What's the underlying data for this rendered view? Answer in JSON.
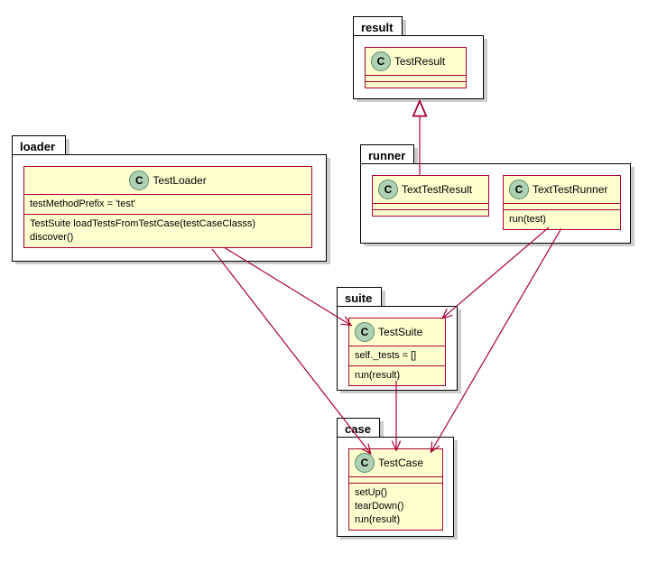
{
  "packages": {
    "result": {
      "label": "result"
    },
    "runner": {
      "label": "runner"
    },
    "loader": {
      "label": "loader"
    },
    "suite": {
      "label": "suite"
    },
    "case": {
      "label": "case"
    }
  },
  "classes": {
    "TestResult": {
      "name": "TestResult",
      "attrs": [],
      "methods": []
    },
    "TextTestResult": {
      "name": "TextTestResult",
      "attrs": [],
      "methods": []
    },
    "TextTestRunner": {
      "name": "TextTestRunner",
      "attrs": [],
      "methods": [
        "run(test)"
      ]
    },
    "TestLoader": {
      "name": "TestLoader",
      "attrs": [
        "testMethodPrefix = 'test'"
      ],
      "methods": [
        "TestSuite loadTestsFromTestCase(testCaseClasss)",
        "discover()"
      ]
    },
    "TestSuite": {
      "name": "TestSuite",
      "attrs": [
        "self._tests = []"
      ],
      "methods": [
        "run(result)"
      ]
    },
    "TestCase": {
      "name": "TestCase",
      "attrs": [],
      "methods": [
        "setUp()",
        "tearDown()",
        "run(result)"
      ]
    }
  },
  "chart_data": {
    "type": "uml-class-diagram",
    "packages": [
      "result",
      "runner",
      "loader",
      "suite",
      "case"
    ],
    "classes": {
      "result": [
        "TestResult"
      ],
      "runner": [
        "TextTestResult",
        "TextTestRunner"
      ],
      "loader": [
        "TestLoader"
      ],
      "suite": [
        "TestSuite"
      ],
      "case": [
        "TestCase"
      ]
    },
    "relations": [
      {
        "from": "TextTestResult",
        "to": "TestResult",
        "type": "inheritance"
      },
      {
        "from": "TestLoader",
        "to": "TestSuite",
        "type": "dependency"
      },
      {
        "from": "TestLoader",
        "to": "TestCase",
        "type": "dependency"
      },
      {
        "from": "TextTestRunner",
        "to": "TestSuite",
        "type": "dependency"
      },
      {
        "from": "TextTestRunner",
        "to": "TestCase",
        "type": "dependency"
      },
      {
        "from": "TestSuite",
        "to": "TestCase",
        "type": "dependency"
      }
    ]
  }
}
